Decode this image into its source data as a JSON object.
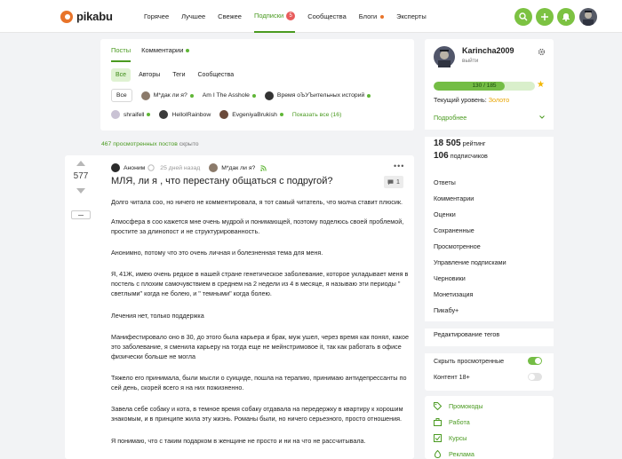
{
  "header": {
    "logo_text": "pikabu",
    "nav": [
      {
        "label": "Горячее"
      },
      {
        "label": "Лучшее"
      },
      {
        "label": "Свежее"
      },
      {
        "label": "Подписки",
        "badge": "5",
        "active": true
      },
      {
        "label": "Сообщества"
      },
      {
        "label": "Блоги",
        "dot": true
      },
      {
        "label": "Эксперты"
      }
    ],
    "icons": [
      "search-icon",
      "plus-icon",
      "bell-icon"
    ],
    "accent": "#7cc242"
  },
  "feed": {
    "tabs": [
      {
        "label": "Посты"
      },
      {
        "label": "Комментарии"
      }
    ],
    "filters": [
      "Все",
      "Авторы",
      "Теги",
      "Сообщества"
    ],
    "subs_row1": [
      "Все",
      "М*дак ли я?",
      "Am I The Asshole",
      "Время оЪУЪительных историй"
    ],
    "subs_row2": [
      "shraifell",
      "HelloIRainbow",
      "EvgeniyaBrukish"
    ],
    "show_all": "Показать все (16)",
    "viewed_count": "467 просмотренных постов",
    "viewed_hidden": "скрыто"
  },
  "post": {
    "rating": "577",
    "author": "Аноним",
    "time": "25 дней назад",
    "community": "М*дак ли я?",
    "title": "МЛЯ, ли я , что перестану общаться с подругой?",
    "comments": "1",
    "paragraphs": [
      "Долго читала соо, но ничего не комментировала, я тот самый читатель, что молча ставит плюсик.",
      "Атмосфера в соо кажется мне очень мудрой и понимающей, поэтому поделюсь своей проблемой, простите за длинопост и не структурированность.",
      "Анонимно, потому что это очень личная и болезненная тема для меня.",
      "Я, 41Ж, имею очень редкое в нашей стране генетическое заболевание, которое укладывает меня в постель с плохим самочувствием в среднем на 2 недели из 4 в месяце, я называю эти периоды \" светлыми\" когда не болею, и \" темными\" когда болею.",
      "Лечения нет, только поддержка",
      "Манифестировало оно в 30, до этого была карьера и брак, муж ушел, через время как понял, какое это заболевание, я сменила карьеру на тогда еще не мейнстримовое it, так как работать в офисе физически больше не могла",
      "Тяжело его принимала, были мысли о суициде, пошла на терапию, принимаю антидепрессанты по сей день, скорей всего я на них пожизненно.",
      "Завела себе собаку и кота, в темное время собаку отдавала на передержку в квартиру к хорошим знакомым, и в принципе жила эту жизнь. Романы были, но ничего серьезного, просто отношения.",
      "Я понимаю, что с таким подарком в женщине не просто и ни на что не рассчитывала."
    ]
  },
  "sidebar": {
    "username": "Karincha2009",
    "logout": "выйти",
    "progress_label": "130 / 185",
    "progress_fraction": 0.7,
    "level_label": "Текущий уровень:",
    "level_value": "Золото",
    "more": "Подробнее",
    "rating_value": "18 505",
    "rating_label": "рейтинг",
    "subs_value": "106",
    "subs_label": "подписчиков",
    "menu": [
      "Ответы",
      "Комментарии",
      "Оценки",
      "Сохраненные",
      "Просмотренное",
      "Управление подписками",
      "Черновики",
      "Монетизация",
      "Пикабу+"
    ],
    "edit_tags": "Редактирование тегов",
    "hide_viewed": "Скрыть просмотренные",
    "content18": "Контент 18+",
    "promo": [
      "Промокоды",
      "Работа",
      "Курсы",
      "Реклама"
    ]
  }
}
